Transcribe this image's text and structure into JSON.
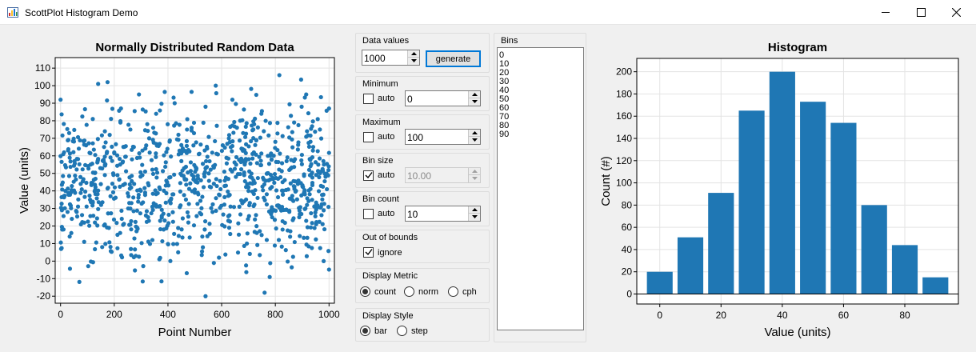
{
  "window": {
    "title": "ScottPlot Histogram Demo",
    "app_icon": "app-chart-icon",
    "minimize_icon": "minimize-icon",
    "maximize_icon": "maximize-icon",
    "close_icon": "close-icon"
  },
  "colors": {
    "accent": "#1f77b4",
    "focus_border": "#0078d7",
    "window_bg": "#f0f0f0"
  },
  "controls": {
    "data_values": {
      "title": "Data values",
      "value": "1000",
      "generate_label": "generate"
    },
    "minimum": {
      "title": "Minimum",
      "auto_label": "auto",
      "auto_checked": false,
      "value": "0"
    },
    "maximum": {
      "title": "Maximum",
      "auto_label": "auto",
      "auto_checked": false,
      "value": "100"
    },
    "bin_size": {
      "title": "Bin size",
      "auto_label": "auto",
      "auto_checked": true,
      "value": "10.00"
    },
    "bin_count": {
      "title": "Bin count",
      "auto_label": "auto",
      "auto_checked": false,
      "value": "10"
    },
    "out_of_bounds": {
      "title": "Out of bounds",
      "ignore_label": "ignore",
      "ignore_checked": true
    },
    "display_metric": {
      "title": "Display Metric",
      "options": [
        "count",
        "norm",
        "cph"
      ],
      "selected": "count"
    },
    "display_style": {
      "title": "Display Style",
      "options": [
        "bar",
        "step"
      ],
      "selected": "bar"
    }
  },
  "bins": {
    "title": "Bins",
    "items": [
      "0",
      "10",
      "20",
      "30",
      "40",
      "50",
      "60",
      "70",
      "80",
      "90"
    ]
  },
  "chart_data": [
    {
      "type": "scatter",
      "title": "Normally Distributed Random Data",
      "xlabel": "Point Number",
      "ylabel": "Value (units)",
      "xlim": [
        -20,
        1020
      ],
      "ylim": [
        -24,
        116
      ],
      "xticks": [
        "0",
        "200",
        "400",
        "600",
        "800",
        "1000"
      ],
      "yticks": [
        "-20",
        "-10",
        "0",
        "10",
        "20",
        "30",
        "40",
        "50",
        "60",
        "70",
        "80",
        "90",
        "100",
        "110"
      ],
      "grid": true,
      "n_points": 1000,
      "color": "#1f77b4",
      "series": [
        {
          "x": [
            0,
            6,
            18,
            32,
            40,
            52,
            60,
            75,
            88,
            95,
            110,
            120,
            128,
            140,
            148,
            155,
            165,
            175,
            186,
            200,
            212,
            225,
            240,
            252,
            266,
            280,
            292,
            305,
            318,
            330,
            342,
            356,
            370,
            384,
            398,
            410,
            425,
            438,
            450,
            462,
            476,
            488,
            500,
            515,
            528,
            540,
            552,
            566,
            578,
            590,
            604,
            616,
            628,
            640,
            654,
            666,
            680,
            694,
            706,
            720,
            734,
            748,
            760,
            775,
            788,
            800,
            815,
            828,
            842,
            856,
            870,
            884,
            898,
            912,
            926,
            940,
            952,
            966,
            980,
            992,
            1000
          ],
          "y": [
            92,
            18,
            40,
            73,
            16,
            57,
            28,
            44,
            11,
            66,
            35,
            81,
            22,
            101,
            53,
            8,
            74,
            102,
            37,
            62,
            15,
            87,
            44,
            30,
            58,
            3,
            95,
            49,
            26,
            70,
            12,
            84,
            41,
            18,
            64,
            33,
            90,
            5,
            57,
            47,
            22,
            76,
            39,
            61,
            14,
            88,
            50,
            28,
            100,
            2,
            66,
            43,
            19,
            92,
            55,
            31,
            73,
            10,
            48,
            62,
            36,
            84,
            -18,
            46,
            25,
            68,
            106,
            38,
            57,
            17,
            79,
            44,
            88,
            30,
            52,
            63,
            21,
            75,
            0,
            41,
            87
          ]
        }
      ]
    },
    {
      "type": "bar",
      "title": "Histogram",
      "xlabel": "Value (units)",
      "ylabel": "Count (#)",
      "categories": [
        "0",
        "10",
        "20",
        "30",
        "40",
        "50",
        "60",
        "70",
        "80",
        "90"
      ],
      "x": [
        0,
        10,
        20,
        30,
        40,
        50,
        60,
        70,
        80,
        90
      ],
      "values": [
        20,
        51,
        91,
        165,
        200,
        173,
        154,
        80,
        44,
        15
      ],
      "xlim": [
        -7.5,
        97.5
      ],
      "ylim": [
        -9,
        212
      ],
      "xticks": [
        "0",
        "20",
        "40",
        "60",
        "80"
      ],
      "yticks": [
        "0",
        "20",
        "40",
        "60",
        "80",
        "100",
        "120",
        "140",
        "160",
        "180",
        "200"
      ],
      "grid": true,
      "color": "#1f77b4"
    }
  ]
}
